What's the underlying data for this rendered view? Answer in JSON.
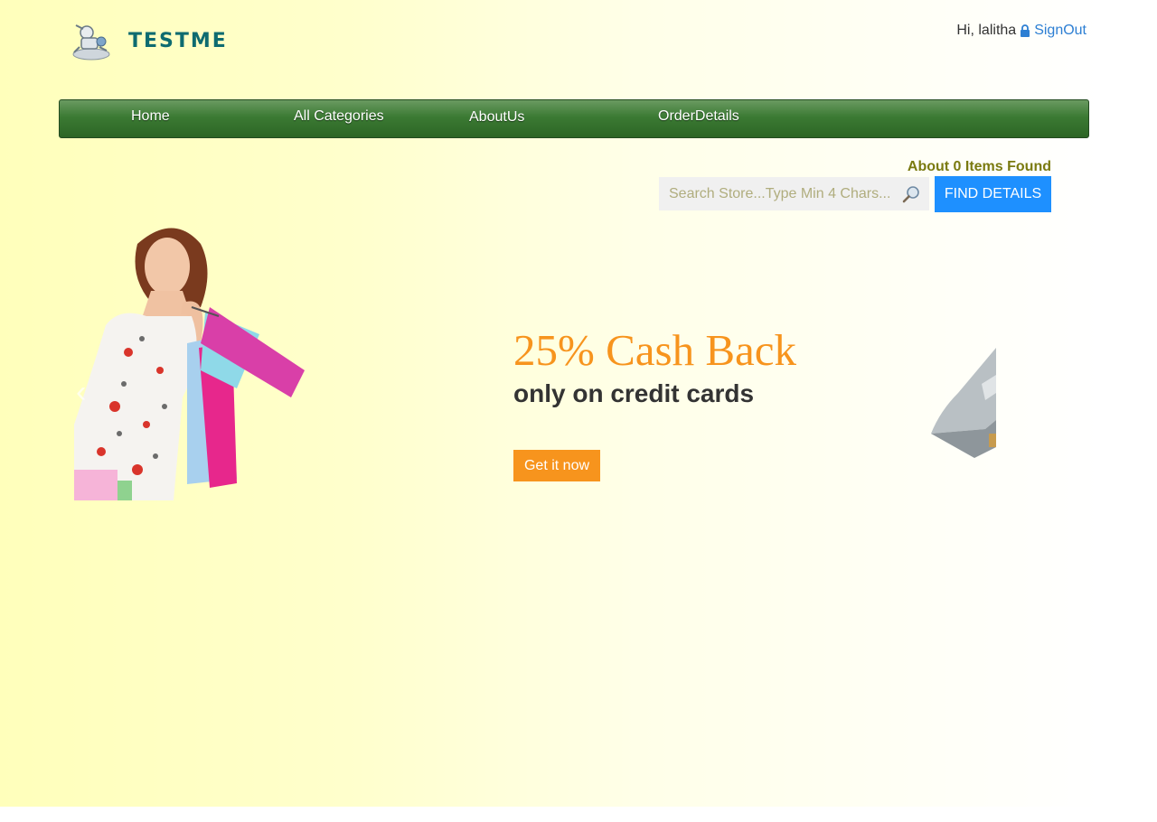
{
  "header": {
    "logo_text": "TESTME",
    "greeting": "Hi, lalitha",
    "signout_label": "SignOut"
  },
  "nav": {
    "items": [
      {
        "label": "Home"
      },
      {
        "label": "All Categories"
      },
      {
        "label": "AboutUs"
      },
      {
        "label": "OrderDetails"
      }
    ]
  },
  "search": {
    "results_text": "About 0 Items Found",
    "placeholder": "Search Store...Type Min 4 Chars...",
    "value": "",
    "button_label": "FIND DETAILS"
  },
  "carousel": {
    "title": "25% Cash Back",
    "subtitle": "only on credit cards",
    "cta_label": "Get it now",
    "prev_glyph": "‹"
  },
  "colors": {
    "accent_orange": "#f7941d",
    "nav_green": "#3b7a33",
    "button_blue": "#1e90ff",
    "logo_teal": "#0e6b70",
    "found_text": "#7a7a10"
  },
  "icons": {
    "logo": "robot-logo-icon",
    "lock": "lock-icon",
    "search": "magnifier-icon"
  }
}
